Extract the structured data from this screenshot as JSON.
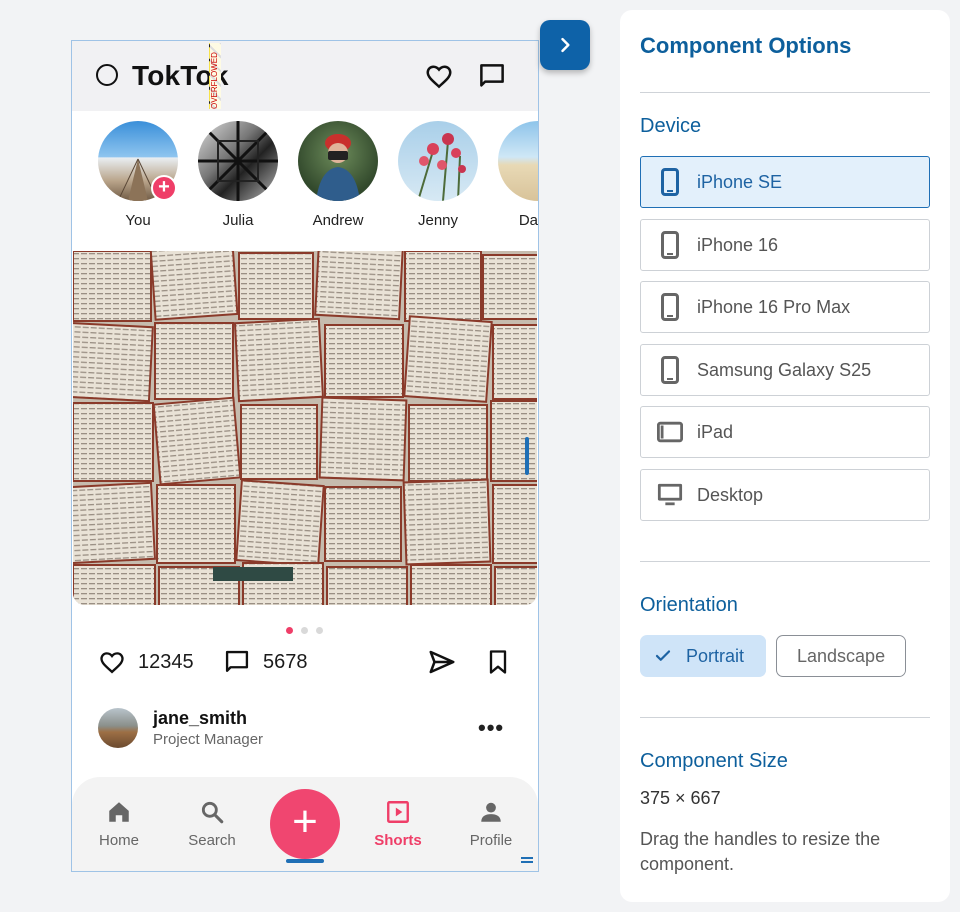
{
  "app": {
    "title": "TokTok",
    "overflow_label": "OVERFLOWED BY 5"
  },
  "stories": [
    {
      "name": "You",
      "has_add_badge": true
    },
    {
      "name": "Julia"
    },
    {
      "name": "Andrew"
    },
    {
      "name": "Jenny"
    },
    {
      "name": "David"
    }
  ],
  "post": {
    "image_pages": 3,
    "active_page": 1,
    "likes": "12345",
    "comments": "5678",
    "author_name": "jane_smith",
    "author_role": "Project Manager",
    "more_label": "•••"
  },
  "bottom_nav": {
    "items": [
      {
        "label": "Home",
        "icon": "home-icon"
      },
      {
        "label": "Search",
        "icon": "search-icon"
      },
      {
        "label": "Shorts",
        "icon": "play-square-icon",
        "active": true
      },
      {
        "label": "Profile",
        "icon": "person-icon"
      }
    ],
    "fab_label": "+"
  },
  "panel": {
    "title": "Component Options",
    "device_section": "Device",
    "devices": [
      {
        "label": "iPhone SE",
        "icon": "phone-icon",
        "selected": true
      },
      {
        "label": "iPhone 16",
        "icon": "phone-icon"
      },
      {
        "label": "iPhone 16 Pro Max",
        "icon": "phone-icon"
      },
      {
        "label": "Samsung Galaxy S25",
        "icon": "phone-icon"
      },
      {
        "label": "iPad",
        "icon": "tablet-icon"
      },
      {
        "label": "Desktop",
        "icon": "monitor-icon"
      }
    ],
    "orientation_section": "Orientation",
    "orientation": {
      "portrait": "Portrait",
      "landscape": "Landscape",
      "selected": "portrait"
    },
    "size_section": "Component Size",
    "size_value": "375 × 667",
    "help_text": "Drag the handles to resize the component."
  },
  "colors": {
    "accent": "#0d5f9c",
    "brand_pink": "#ef3e68",
    "selected_bg": "#e3f0fb"
  }
}
